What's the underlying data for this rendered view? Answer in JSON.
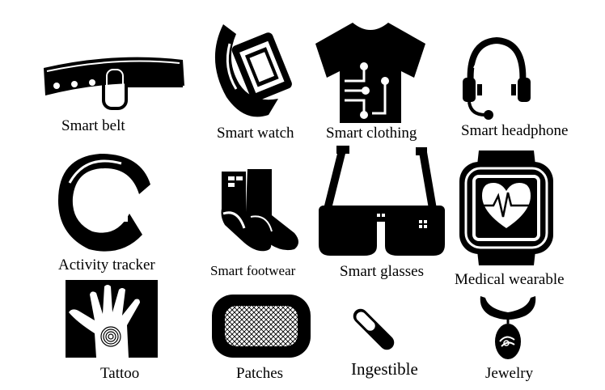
{
  "colors": {
    "ink": "#000000",
    "paper": "#ffffff"
  },
  "items": [
    {
      "name": "smart-belt",
      "label": "Smart belt",
      "icon": "belt-icon"
    },
    {
      "name": "smart-watch",
      "label": "Smart watch",
      "icon": "watch-icon"
    },
    {
      "name": "smart-clothing",
      "label": "Smart clothing",
      "icon": "tshirt-icon"
    },
    {
      "name": "smart-headphone",
      "label": "Smart headphone",
      "icon": "headset-icon"
    },
    {
      "name": "activity-tracker",
      "label": "Activity tracker",
      "icon": "bracelet-icon"
    },
    {
      "name": "smart-footwear",
      "label": "Smart footwear",
      "icon": "socks-icon"
    },
    {
      "name": "smart-glasses",
      "label": "Smart glasses",
      "icon": "glasses-icon"
    },
    {
      "name": "medical-wearable",
      "label": "Medical wearable",
      "icon": "heart-monitor-icon"
    },
    {
      "name": "tattoo",
      "label": "Tattoo",
      "icon": "hand-tattoo-icon"
    },
    {
      "name": "patches",
      "label": "Patches",
      "icon": "patch-icon"
    },
    {
      "name": "ingestible",
      "label": "Ingestible",
      "icon": "pill-icon"
    },
    {
      "name": "jewelry",
      "label": "Jewelry",
      "icon": "necklace-icon"
    }
  ]
}
